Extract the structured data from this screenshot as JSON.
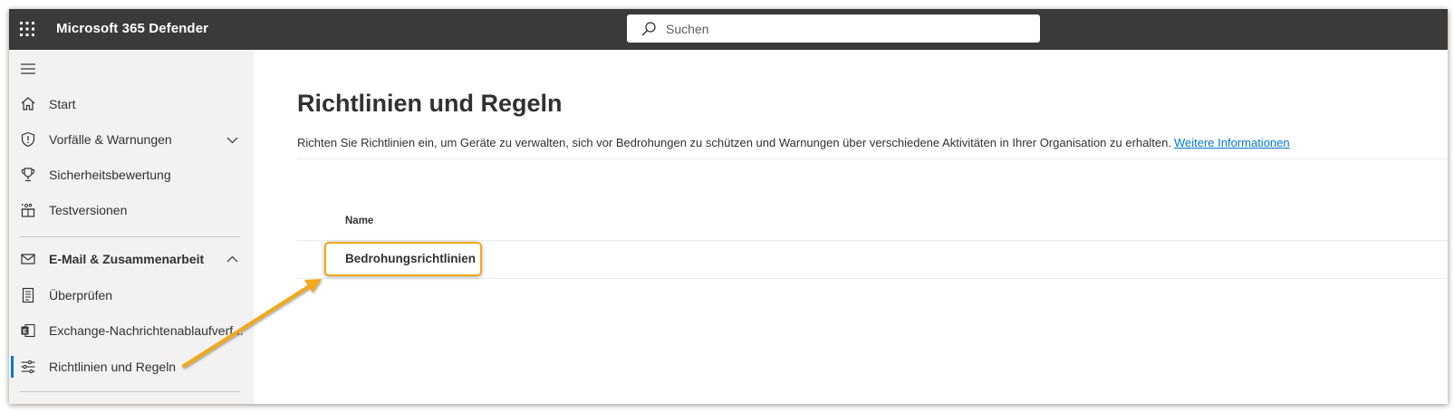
{
  "header": {
    "app_title": "Microsoft 365 Defender",
    "search_placeholder": "Suchen"
  },
  "sidebar": {
    "items": [
      {
        "label": "Start",
        "icon": "home-icon"
      },
      {
        "label": "Vorfälle & Warnungen",
        "icon": "shield-icon",
        "expandable": true,
        "expanded": false
      },
      {
        "label": "Sicherheitsbewertung",
        "icon": "trophy-icon"
      },
      {
        "label": "Testversionen",
        "icon": "trials-icon"
      },
      {
        "label": "E-Mail & Zusammenarbeit",
        "icon": "mail-icon",
        "expandable": true,
        "expanded": true
      },
      {
        "label": "Überprüfen",
        "icon": "review-icon"
      },
      {
        "label": "Exchange-Nachrichtenablaufverf...",
        "icon": "exchange-icon"
      },
      {
        "label": "Richtlinien und Regeln",
        "icon": "policy-sliders-icon",
        "active": true
      }
    ]
  },
  "main": {
    "title": "Richtlinien und Regeln",
    "description": "Richten Sie Richtlinien ein, um Geräte zu verwalten, sich vor Bedrohungen zu schützen und Warnungen über verschiedene Aktivitäten in Ihrer Organisation zu erhalten.",
    "more_info_link": "Weitere Informationen",
    "table": {
      "column_header": "Name",
      "rows": [
        "Bedrohungsrichtlinien"
      ]
    }
  },
  "colors": {
    "topbar": "#3b3a39",
    "sidebar": "#f3f2f1",
    "accent": "#0078d4",
    "annotation": "#f0a81c"
  }
}
